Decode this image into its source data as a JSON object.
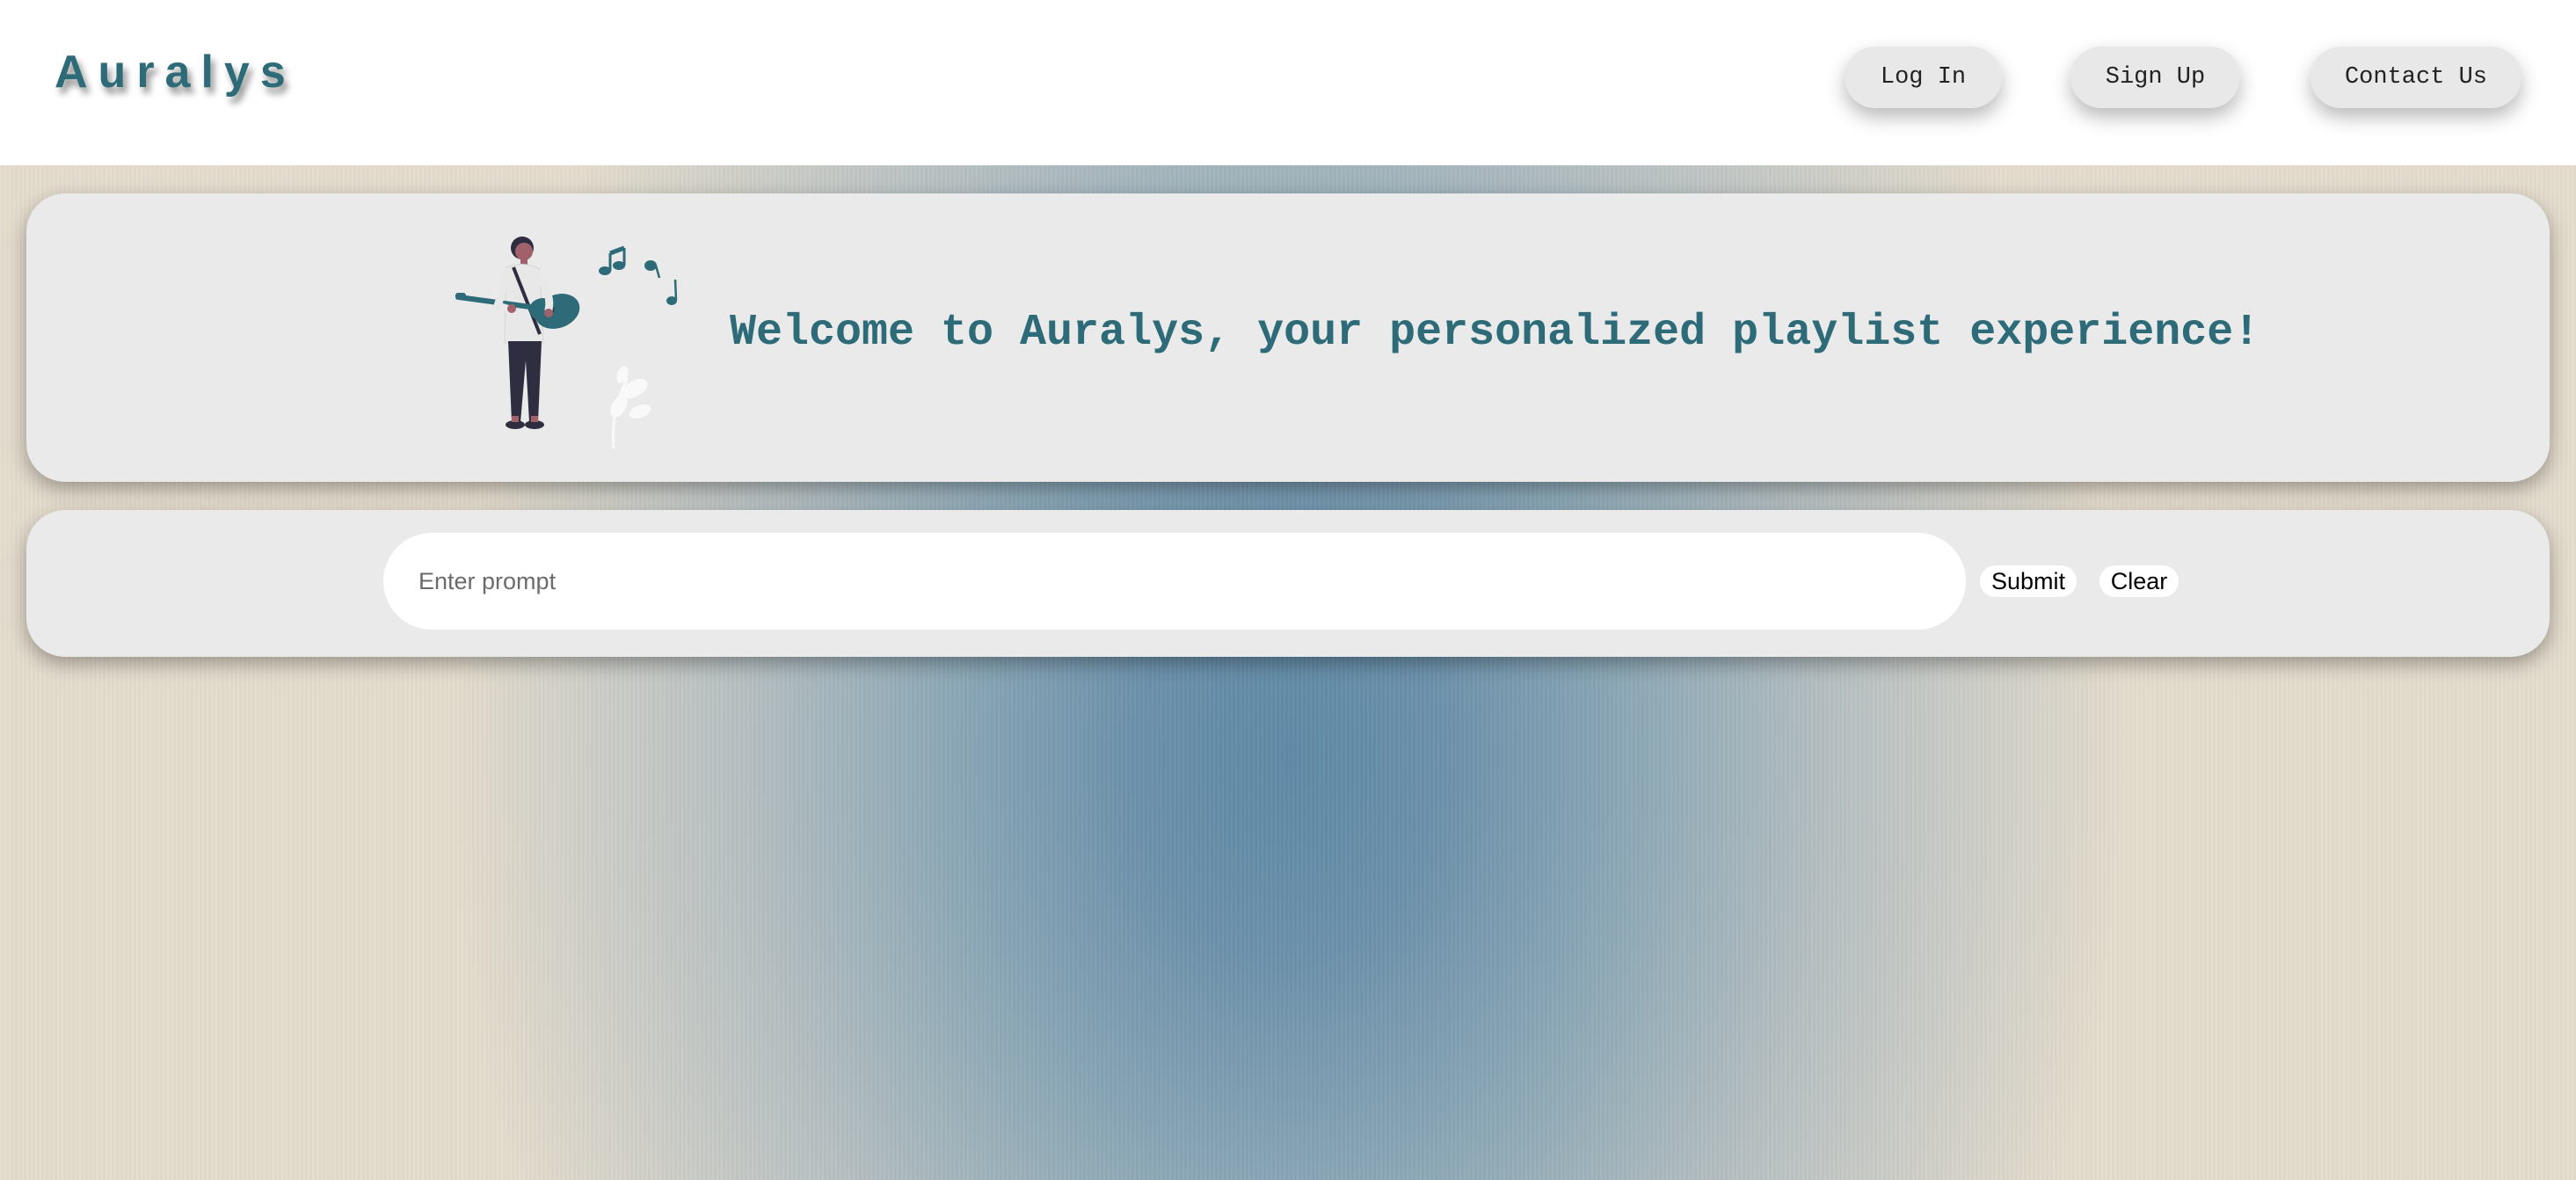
{
  "header": {
    "logo": "Auralys",
    "nav": {
      "login_label": "Log In",
      "signup_label": "Sign Up",
      "contact_label": "Contact Us"
    }
  },
  "welcome": {
    "message": "Welcome to Auralys, your personalized playlist experience!",
    "illustration": "person-playing-guitar-illustration"
  },
  "prompt": {
    "placeholder": "Enter prompt",
    "value": "",
    "submit_label": "Submit",
    "clear_label": "Clear"
  },
  "colors": {
    "accent": "#2d6b78",
    "card_background": "#eaeaea",
    "header_background": "#ffffff"
  }
}
